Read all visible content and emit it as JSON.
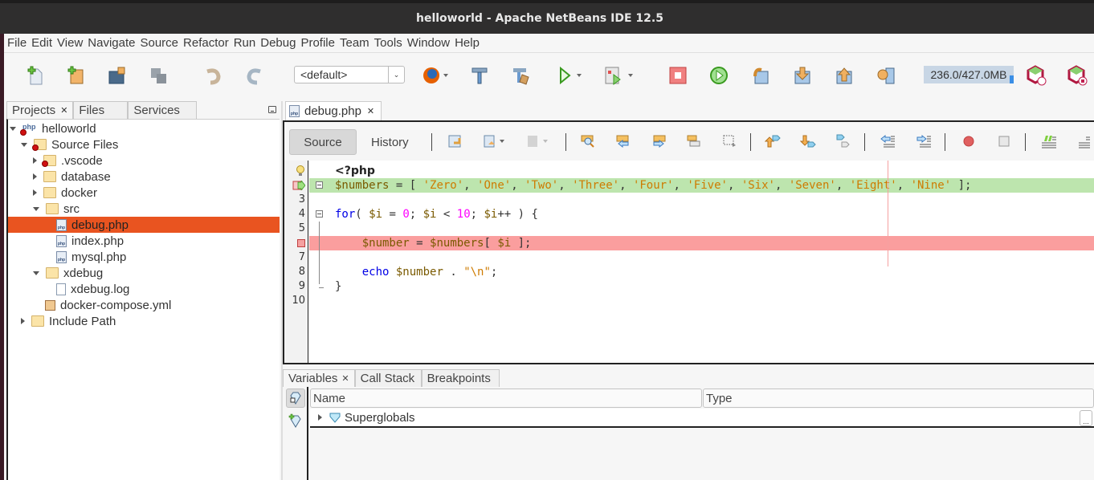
{
  "window": {
    "title": "helloworld - Apache NetBeans IDE 12.5"
  },
  "menu": [
    "File",
    "Edit",
    "View",
    "Navigate",
    "Source",
    "Refactor",
    "Run",
    "Debug",
    "Profile",
    "Team",
    "Tools",
    "Window",
    "Help"
  ],
  "toolbar": {
    "config_value": "<default>",
    "memory": "236.0/427.0MB",
    "memory_used_fraction": 0.55,
    "buttons": [
      "new-file",
      "new-project",
      "open-project",
      "save-all",
      "undo",
      "redo",
      "browser",
      "build",
      "clean-build",
      "run",
      "debug",
      "finish-debug",
      "continue",
      "step-over",
      "step-into",
      "step-out",
      "run-to-cursor",
      "profile-startup",
      "profile-stop"
    ]
  },
  "left_panel": {
    "tabs": [
      {
        "label": "Projects",
        "active": true,
        "closable": true
      },
      {
        "label": "Files",
        "active": false
      },
      {
        "label": "Services",
        "active": false
      }
    ],
    "tree": [
      {
        "label": "helloworld",
        "depth": 0,
        "expanded": true,
        "icon": "php-project-icon",
        "error": true
      },
      {
        "label": "Source Files",
        "depth": 1,
        "expanded": true,
        "icon": "source-folder-icon",
        "error": true
      },
      {
        "label": ".vscode",
        "depth": 2,
        "expanded": false,
        "icon": "folder-icon",
        "error": true
      },
      {
        "label": "database",
        "depth": 2,
        "expanded": false,
        "icon": "folder-icon"
      },
      {
        "label": "docker",
        "depth": 2,
        "expanded": false,
        "icon": "folder-icon"
      },
      {
        "label": "src",
        "depth": 2,
        "expanded": true,
        "icon": "web-folder-icon"
      },
      {
        "label": "debug.php",
        "depth": 3,
        "icon": "php-file-icon",
        "selected": true
      },
      {
        "label": "index.php",
        "depth": 3,
        "icon": "php-file-icon"
      },
      {
        "label": "mysql.php",
        "depth": 3,
        "icon": "php-file-icon"
      },
      {
        "label": "xdebug",
        "depth": 2,
        "expanded": true,
        "icon": "folder-open-icon"
      },
      {
        "label": "xdebug.log",
        "depth": 3,
        "icon": "text-file-icon"
      },
      {
        "label": "docker-compose.yml",
        "depth": 2,
        "icon": "yml-file-icon"
      },
      {
        "label": "Include Path",
        "depth": 1,
        "expanded": false,
        "icon": "include-path-icon"
      }
    ]
  },
  "editor": {
    "tab_label": "debug.php",
    "source_label": "Source",
    "history_label": "History",
    "lines": [
      {
        "n": "",
        "marker": "hint",
        "code": "<?php"
      },
      {
        "n": "",
        "marker": "current",
        "code": "$numbers = [ 'Zero', 'One', 'Two', 'Three', 'Four', 'Five', 'Six', 'Seven', 'Eight', 'Nine' ];"
      },
      {
        "n": "3",
        "code": ""
      },
      {
        "n": "4",
        "code": "for( $i = 0; $i < 10; $i++ ) {"
      },
      {
        "n": "5",
        "code": ""
      },
      {
        "n": "",
        "marker": "breakpoint",
        "code": "    $number = $numbers[ $i ];"
      },
      {
        "n": "7",
        "code": ""
      },
      {
        "n": "8",
        "code": "    echo $number . \"\\n\";"
      },
      {
        "n": "9",
        "code": "}"
      },
      {
        "n": "10",
        "code": ""
      }
    ]
  },
  "bottom_panel": {
    "tabs": [
      {
        "label": "Variables",
        "active": true,
        "closable": true
      },
      {
        "label": "Call Stack",
        "active": false
      },
      {
        "label": "Breakpoints",
        "active": false
      }
    ],
    "columns": [
      "Name",
      "Type"
    ],
    "rows": [
      {
        "name": "Superglobals"
      }
    ],
    "ellipsis": "..."
  },
  "colors": {
    "selection": "#e95420",
    "current_line": "#bde5ae",
    "breakpoint_line": "#fa9e9e",
    "string": "#ce7b00",
    "number": "#ff00ff",
    "keyword": "#0000e6"
  }
}
